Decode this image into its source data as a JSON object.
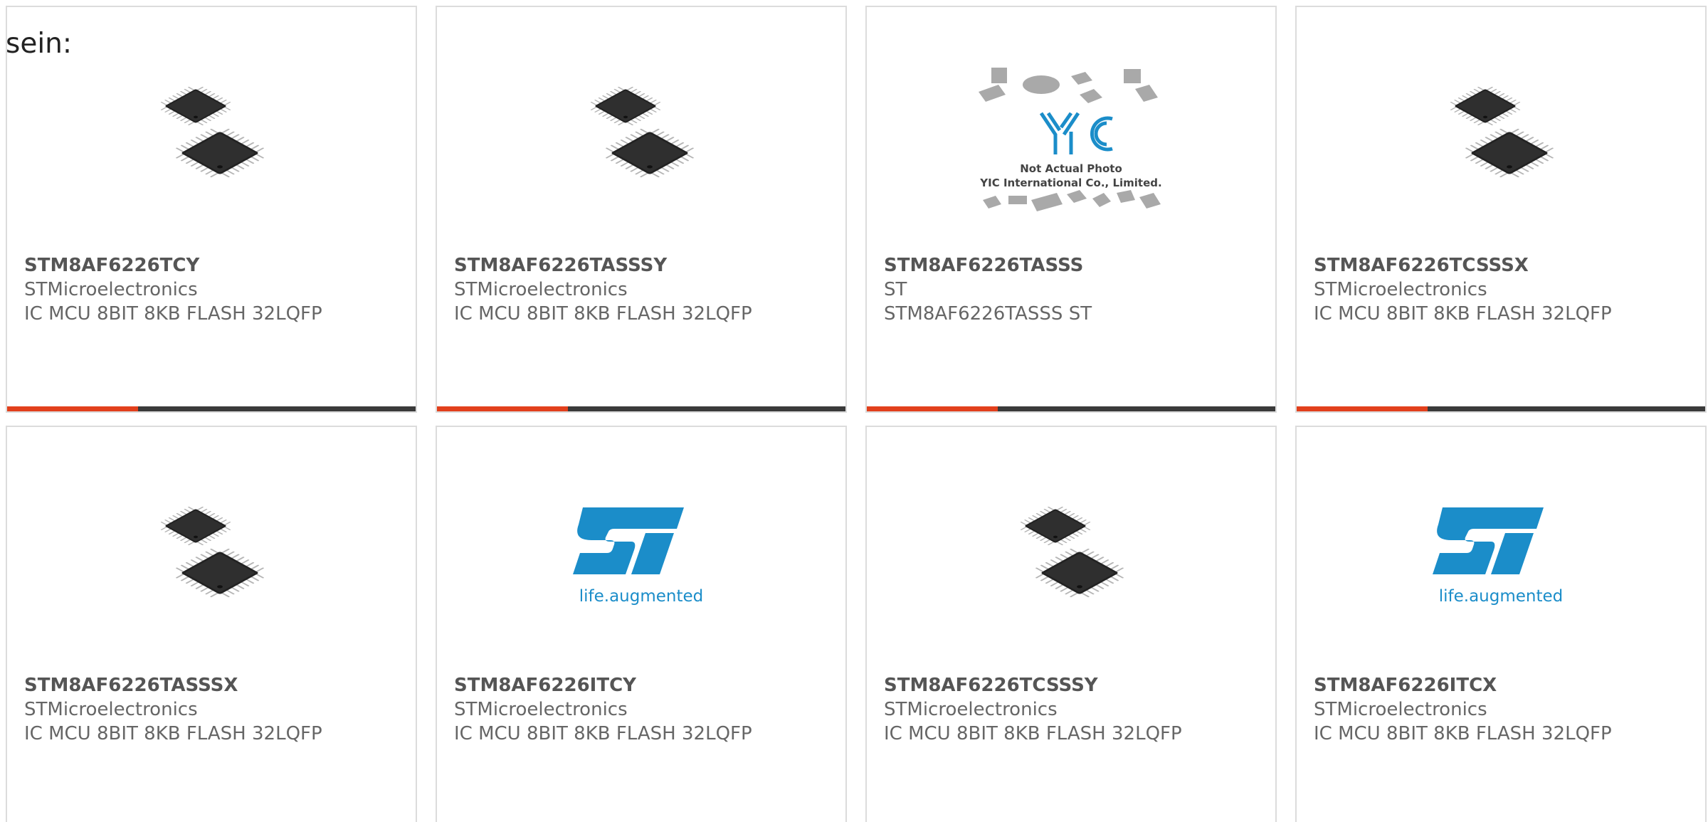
{
  "intro_text": "sein:",
  "colors": {
    "accent": "#e2401c",
    "bar_track": "#3a3a3a",
    "border": "#dcdcdc",
    "st_logo_blue": "#1b8dc9"
  },
  "products": [
    {
      "part_number": "STM8AF6226TCY",
      "manufacturer": "STMicroelectronics",
      "description": "IC MCU 8BIT 8KB FLASH 32LQFP",
      "image": "lqfp-chip-icon",
      "accent_fraction": 0.32
    },
    {
      "part_number": "STM8AF6226TASSSY",
      "manufacturer": "STMicroelectronics",
      "description": "IC MCU 8BIT 8KB FLASH 32LQFP",
      "image": "lqfp-chip-icon",
      "accent_fraction": 0.32
    },
    {
      "part_number": "STM8AF6226TASSS",
      "manufacturer": "ST",
      "description": "STM8AF6226TASSS ST",
      "image": "yic-placeholder-icon",
      "image_caption": [
        "Not Actual Photo",
        "YIC International Co., Limited."
      ],
      "logo_text": "YIC",
      "accent_fraction": 0.32
    },
    {
      "part_number": "STM8AF6226TCSSSX",
      "manufacturer": "STMicroelectronics",
      "description": "IC MCU 8BIT 8KB FLASH 32LQFP",
      "image": "lqfp-chip-icon",
      "accent_fraction": 0.32
    },
    {
      "part_number": "STM8AF6226TASSSX",
      "manufacturer": "STMicroelectronics",
      "description": "IC MCU 8BIT 8KB FLASH 32LQFP",
      "image": "lqfp-chip-icon",
      "accent_fraction": 0.32
    },
    {
      "part_number": "STM8AF6226ITCY",
      "manufacturer": "STMicroelectronics",
      "description": "IC MCU 8BIT 8KB FLASH 32LQFP",
      "image": "st-logo-icon",
      "logo_tagline": "life.augmented",
      "accent_fraction": 0.32
    },
    {
      "part_number": "STM8AF6226TCSSSY",
      "manufacturer": "STMicroelectronics",
      "description": "IC MCU 8BIT 8KB FLASH 32LQFP",
      "image": "lqfp-chip-icon",
      "accent_fraction": 0.32
    },
    {
      "part_number": "STM8AF6226ITCX",
      "manufacturer": "STMicroelectronics",
      "description": "IC MCU 8BIT 8KB FLASH 32LQFP",
      "image": "st-logo-icon",
      "logo_tagline": "life.augmented",
      "accent_fraction": 0.32
    }
  ]
}
